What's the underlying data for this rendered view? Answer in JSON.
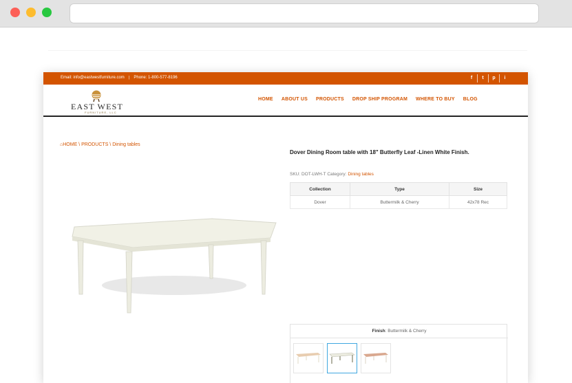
{
  "topbar": {
    "email": "Email: info@eastwestfurniture.com",
    "separator": "|",
    "phone": "Phone: 1-800-577-8196",
    "social": [
      "f",
      "t",
      "p",
      "i"
    ]
  },
  "logo": {
    "name": "EAST WEST",
    "sub": "FURNITURE, LLC"
  },
  "nav": [
    "HOME",
    "ABOUT US",
    "PRODUCTS",
    "DROP SHIP PROGRAM",
    "WHERE TO BUY",
    "BLOG"
  ],
  "breadcrumb": {
    "home": "HOME",
    "products": "PRODUCTS",
    "category": "Dining tables"
  },
  "product": {
    "title": "Dover Dining Room table with 18\" Butterfly Leaf -Linen White Finish.",
    "sku_label": "SKU:",
    "sku": "DOT-LWH-T",
    "category_label": "Category:",
    "category": "Dining tables"
  },
  "spec_table": {
    "headers": [
      "Collection",
      "Type",
      "Size"
    ],
    "row": [
      "Dover",
      "Buttermilk & Cherry",
      "42x78 Rec"
    ]
  },
  "finish": {
    "label": "Finish",
    "value": "Buttermilk & Cherry"
  },
  "colors": {
    "accent": "#d35400",
    "active_swatch": "#3fa7e0"
  }
}
